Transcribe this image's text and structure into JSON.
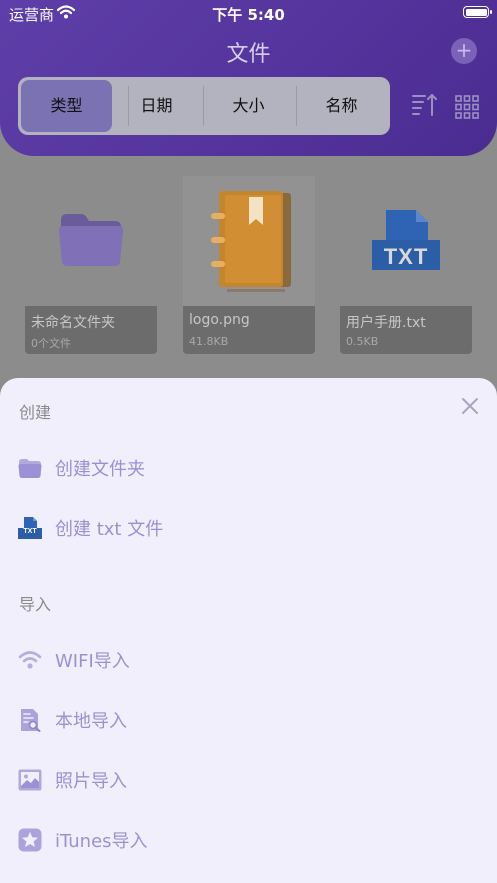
{
  "status_bar": {
    "carrier": "运营商",
    "time": "下午 5:40"
  },
  "header": {
    "title": "文件",
    "add_label": "+",
    "tabs": [
      {
        "label": "类型",
        "active": true
      },
      {
        "label": "日期",
        "active": false
      },
      {
        "label": "大小",
        "active": false
      },
      {
        "label": "名称",
        "active": false
      }
    ],
    "sort_icon": "sort-icon",
    "grid_icon": "grid-view-icon"
  },
  "files": [
    {
      "name": "未命名文件夹",
      "meta": "0个文件",
      "icon": "folder-icon"
    },
    {
      "name": "logo.png",
      "meta": "41.8KB",
      "icon": "notebook-image-icon"
    },
    {
      "name": "用户手册.txt",
      "meta": "0.5KB",
      "icon": "txt-file-icon",
      "badge": "TXT"
    }
  ],
  "sheet": {
    "create_title": "创建",
    "create_items": [
      {
        "label": "创建文件夹",
        "icon": "folder-icon"
      },
      {
        "label": "创建 txt 文件",
        "icon": "txt-file-icon",
        "badge": "TXT"
      }
    ],
    "import_title": "导入",
    "import_items": [
      {
        "label": "WIFI导入",
        "icon": "wifi-icon"
      },
      {
        "label": "本地导入",
        "icon": "local-file-search-icon"
      },
      {
        "label": "照片导入",
        "icon": "photo-icon"
      },
      {
        "label": "iTunes导入",
        "icon": "star-icon"
      }
    ]
  },
  "colors": {
    "header_purple": "#55349d",
    "accent_purple": "#9a92d0",
    "sheet_bg": "#f2effd",
    "icon_orange": "#e08d1e",
    "icon_blue": "#2f64b5"
  }
}
